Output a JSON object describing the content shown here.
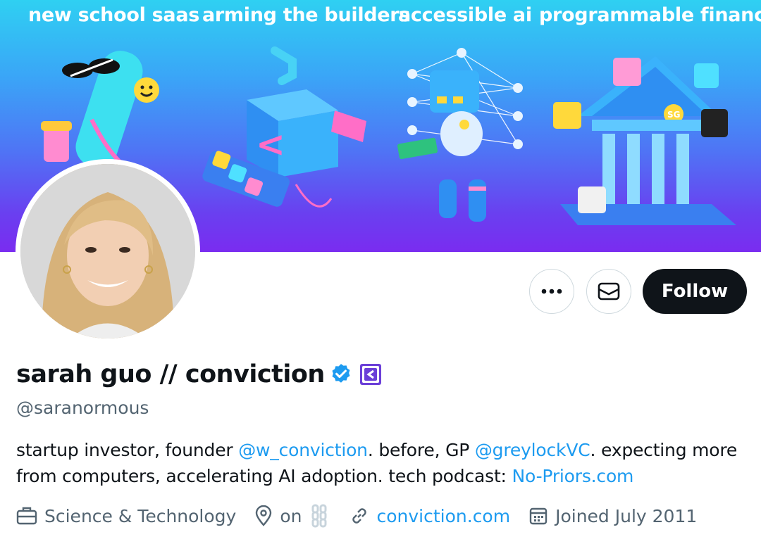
{
  "banner": {
    "captions": [
      "new school saas",
      "arming the builders",
      "accessible ai",
      "programmable finance"
    ]
  },
  "profile": {
    "display_name": "sarah guo // conviction",
    "handle": "@saranormous",
    "bio": {
      "p1": "startup investor, founder ",
      "mention1": "@w_conviction",
      "p2": ". before, GP ",
      "mention2": "@greylockVC",
      "p3": ". expecting more from computers, accelerating AI adoption. tech podcast: ",
      "link": "No-Priors.com"
    },
    "category": "Science & Technology",
    "location": "on",
    "website": "conviction.com",
    "joined": "Joined July 2011"
  },
  "actions": {
    "follow_label": "Follow"
  },
  "icons": {
    "more": "more-horizontal-icon",
    "message": "envelope-icon",
    "verified": "verified-badge-icon",
    "affiliation": "conviction-logo-icon",
    "category": "briefcase-icon",
    "location": "location-pin-icon",
    "website": "link-icon",
    "joined": "calendar-icon"
  },
  "colors": {
    "accent": "#1d9bf0",
    "follow_bg": "#0f1419",
    "secondary_text": "#536471",
    "affiliation_badge": "#6b3fd8"
  }
}
